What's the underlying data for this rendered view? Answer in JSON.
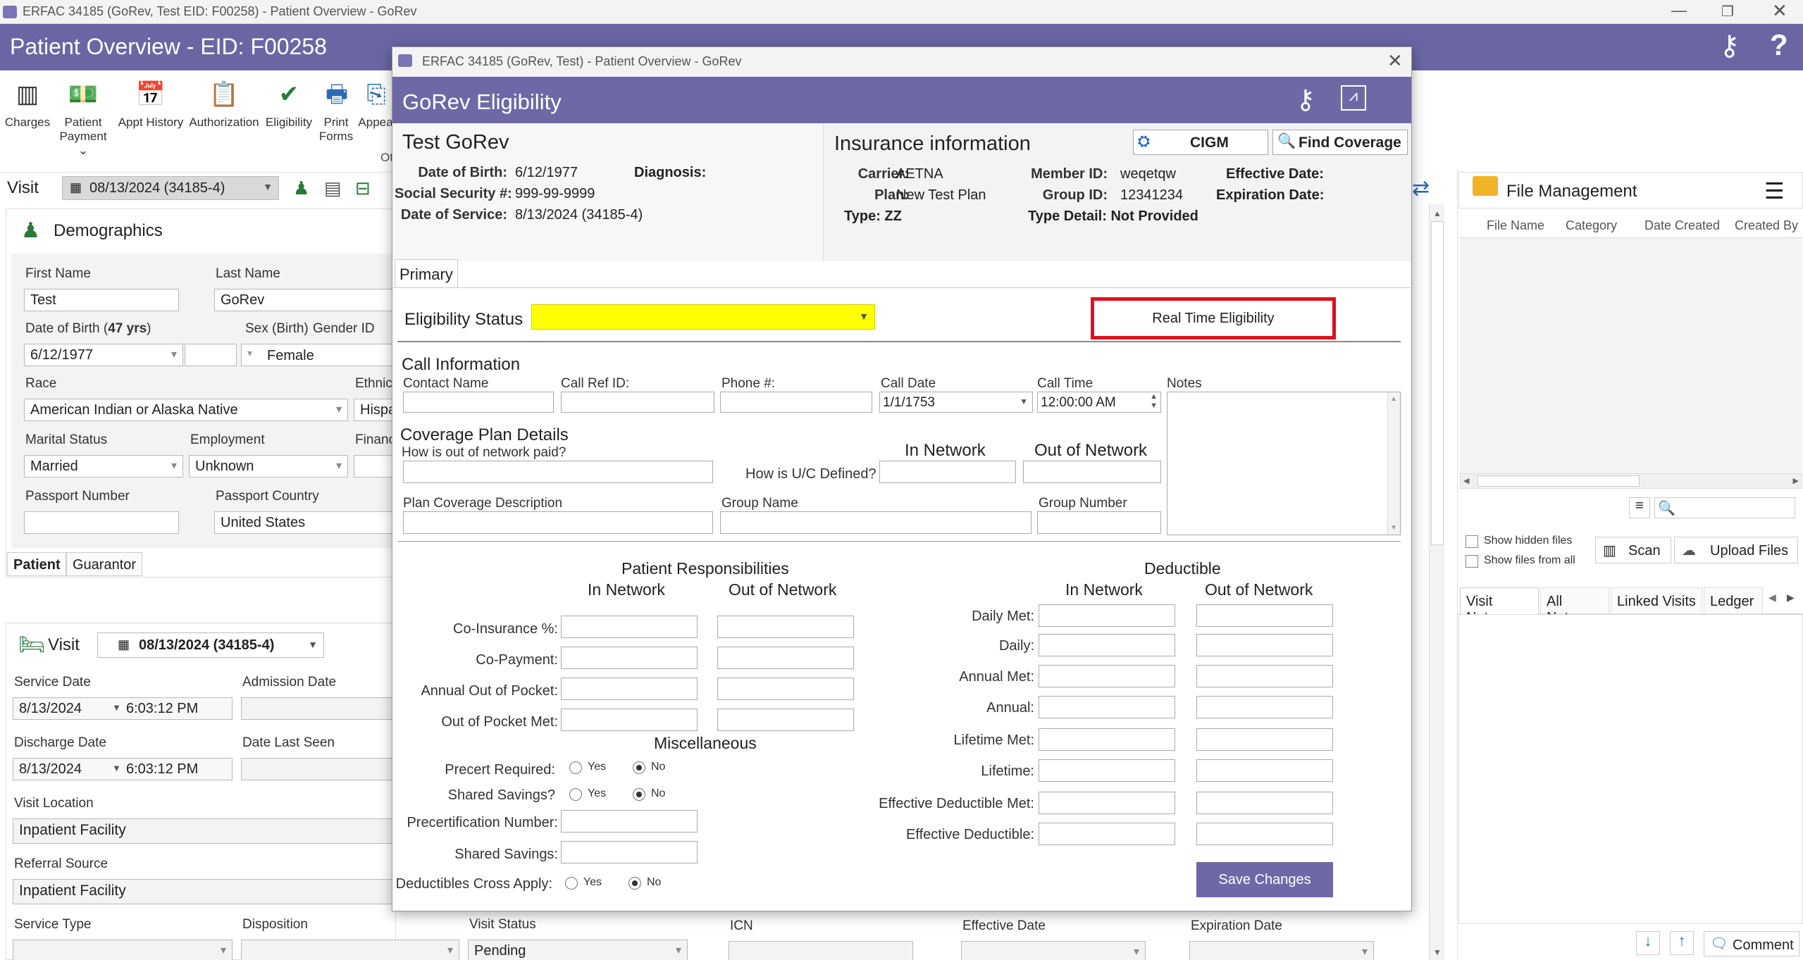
{
  "window": {
    "title": "ERFAC 34185 (GoRev, Test EID: F00258) - Patient Overview - GoRev",
    "header": "Patient Overview - EID: F00258"
  },
  "toolbar": [
    {
      "label": "Charges",
      "icon": "barcode-icon"
    },
    {
      "label": "Patient Payment ⌄",
      "icon": "payment-icon"
    },
    {
      "label": "Appt History",
      "icon": "calendar-icon"
    },
    {
      "label": "Authorization",
      "icon": "authorization-icon"
    },
    {
      "label": "Eligibility",
      "icon": "eligibility-icon"
    },
    {
      "label": "Print Forms",
      "icon": "printer-icon"
    },
    {
      "label": "Appea",
      "icon": "appeal-icon"
    }
  ],
  "toolbar_cut": "Ot",
  "visit_bar": {
    "label": "Visit",
    "selected": "08/13/2024 (34185-4)"
  },
  "demographics": {
    "title": "Demographics",
    "first_name_label": "First Name",
    "first_name": "Test",
    "last_name_label": "Last Name",
    "last_name": "GoRev",
    "dob_label": "Date of Birth (",
    "dob_age": "47 yrs",
    ")": ")",
    "dob": "6/12/1977",
    "sex_label": "Sex (Birth)",
    "gender_label": "Gender ID",
    "gender": "Female",
    "race_label": "Race",
    "race": "American Indian or Alaska Native",
    "ethnic_label": "Ethnic",
    "ethnic": "Hispa",
    "marital_label": "Marital Status",
    "marital": "Married",
    "employment_label": "Employment",
    "employment": "Unknown",
    "finance_label": "Financ",
    "passport_label": "Passport Number",
    "passport_country_label": "Passport Country",
    "passport_country": "United States",
    "tabs": [
      "Patient",
      "Guarantor"
    ]
  },
  "visit_panel": {
    "title": "Visit",
    "selected": "08/13/2024 (34185-4)",
    "service_date_label": "Service Date",
    "service_date": "8/13/2024",
    "service_time": "6:03:12 PM",
    "admission_label": "Admission Date",
    "discharge_label": "Discharge Date",
    "discharge_date": "8/13/2024",
    "discharge_time": "6:03:12 PM",
    "last_seen_label": "Date Last Seen",
    "location_label": "Visit Location",
    "location": "Inpatient Facility",
    "referral_label": "Referral Source",
    "referral": "Inpatient Facility",
    "service_type_label": "Service Type",
    "disposition_label": "Disposition",
    "status_label": "Visit Status",
    "status": "Pending"
  },
  "bottom_strip": {
    "icn": "ICN",
    "effective": "Effective Date",
    "expiration": "Expiration Date"
  },
  "file_mgmt": {
    "title": "File Management",
    "columns": [
      "File Name",
      "Category",
      "Date Created",
      "Created By"
    ],
    "show_hidden": "Show hidden files",
    "show_all": "Show files from all visits",
    "scan": "Scan",
    "upload": "Upload Files",
    "tabs": [
      "Visit Notes",
      "All Notes",
      "Linked Visits",
      "Ledger"
    ],
    "comment": "Comment"
  },
  "dialog": {
    "window_title": "ERFAC 34185 (GoRev, Test) - Patient Overview - GoRev",
    "header": "GoRev Eligibility",
    "patient_name": "Test GoRev",
    "dob_label": "Date of Birth:",
    "dob": "6/12/1977",
    "diag_label": "Diagnosis:",
    "ssn_label": "Social Security #:",
    "ssn": "999-99-9999",
    "dos_label": "Date of Service:",
    "dos": "8/13/2024 (34185-4)",
    "ins_title": "Insurance information",
    "cigm": "CIGM",
    "find_coverage": "Find Coverage",
    "carrier_label": "Carrier:",
    "carrier": "AETNA",
    "plan_label": "Plan:",
    "plan": "New Test Plan",
    "type_label": "Type:",
    "type": "ZZ",
    "member_label": "Member ID:",
    "member": "weqetqw",
    "group_label": "Group ID:",
    "group": "12341234",
    "type_detail_label": "Type Detail:",
    "type_detail": "Not Provided",
    "eff_label": "Effective Date:",
    "exp_label": "Expiration Date:",
    "tab": "Primary",
    "elig_status_label": "Eligibility Status",
    "rte_button": "Real Time Eligibility",
    "call_info": "Call Information",
    "contact_label": "Contact Name",
    "ref_label": "Call Ref ID:",
    "phone_label": "Phone #:",
    "call_date_label": "Call Date",
    "call_date": "1/1/1753",
    "call_time_label": "Call Time",
    "call_time": "12:00:00 AM",
    "notes_label": "Notes",
    "coverage_title": "Coverage Plan Details",
    "oon_paid_label": "How is out of network paid?",
    "uc_label": "How is U/C Defined?",
    "in_network": "In Network",
    "out_network": "Out of Network",
    "plan_desc_label": "Plan Coverage Description",
    "group_name_label": "Group Name",
    "group_number_label": "Group Number",
    "pr_title": "Patient Responsibilities",
    "pr_rows": [
      "Co-Insurance %:",
      "Co-Payment:",
      "Annual Out of Pocket:",
      "Out of Pocket Met:"
    ],
    "misc_title": "Miscellaneous",
    "precert_req": "Precert Required:",
    "shared_savings_q": "Shared Savings?",
    "precert_num": "Precertification Number:",
    "shared_savings": "Shared Savings:",
    "ded_cross": "Deductibles Cross Apply:",
    "yes": "Yes",
    "no": "No",
    "ded_title": "Deductible",
    "ded_rows": [
      "Daily Met:",
      "Daily:",
      "Annual Met:",
      "Annual:",
      "Lifetime Met:",
      "Lifetime:",
      "Effective Deductible Met:",
      "Effective Deductible:"
    ],
    "save": "Save Changes"
  },
  "colors": {
    "header": "#6b66a3",
    "dialog_header": "#6e69a6",
    "yellow": "#ffff00",
    "red": "#e0101e",
    "save": "#6e69a6"
  }
}
